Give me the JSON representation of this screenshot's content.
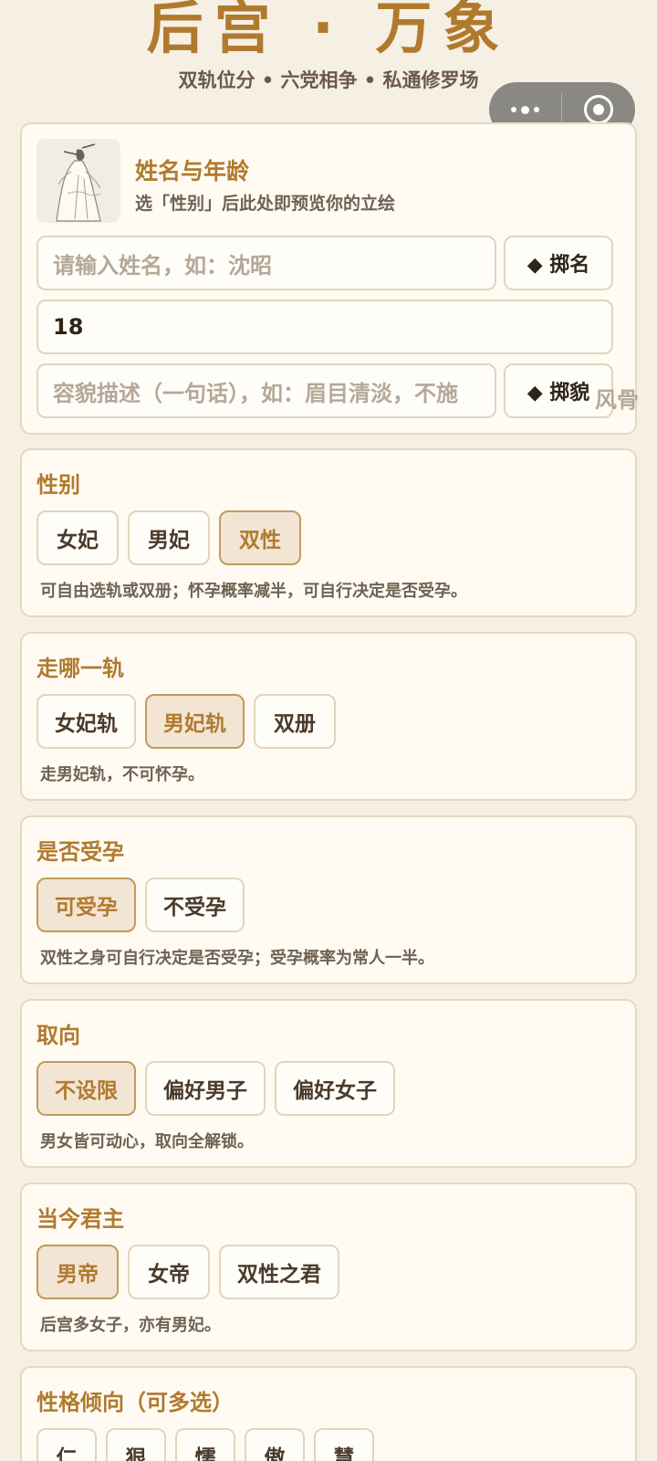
{
  "app": {
    "title": "后宫 · 万象",
    "subtitle": "双轨位分 • 六党相争 • 私通修罗场"
  },
  "profile": {
    "title": "姓名与年龄",
    "hint": "选「性别」后此处即预览你的立绘",
    "name_placeholder": "请输入姓名，如：沈昭",
    "name_dice": "◆ 掷名",
    "age_value": "18",
    "looks_placeholder": "容貌描述（一句话），如：眉目清淡，不施",
    "looks_overflow": "风骨",
    "looks_dice": "◆ 掷貌"
  },
  "gender": {
    "title": "性别",
    "options": [
      "女妃",
      "男妃",
      "双性"
    ],
    "selected": "双性",
    "note": "可自由选轨或双册；怀孕概率减半，可自行决定是否受孕。"
  },
  "track": {
    "title": "走哪一轨",
    "options": [
      "女妃轨",
      "男妃轨",
      "双册"
    ],
    "selected": "男妃轨",
    "note": "走男妃轨，不可怀孕。"
  },
  "pregnancy": {
    "title": "是否受孕",
    "options": [
      "可受孕",
      "不受孕"
    ],
    "selected": "可受孕",
    "note": "双性之身可自行决定是否受孕；受孕概率为常人一半。"
  },
  "orientation": {
    "title": "取向",
    "options": [
      "不设限",
      "偏好男子",
      "偏好女子"
    ],
    "selected": "不设限",
    "note": "男女皆可动心，取向全解锁。"
  },
  "ruler": {
    "title": "当今君主",
    "options": [
      "男帝",
      "女帝",
      "双性之君"
    ],
    "selected": "男帝",
    "note": "后宫多女子，亦有男妃。"
  },
  "personality": {
    "title": "性格倾向（可多选）",
    "options": [
      "仁",
      "狠",
      "懦",
      "傲",
      "慧"
    ]
  },
  "colors": {
    "accent": "#b07a2e",
    "background": "#f6efe4",
    "card": "#fffbf3",
    "selected_bg": "#f2e5d3"
  }
}
